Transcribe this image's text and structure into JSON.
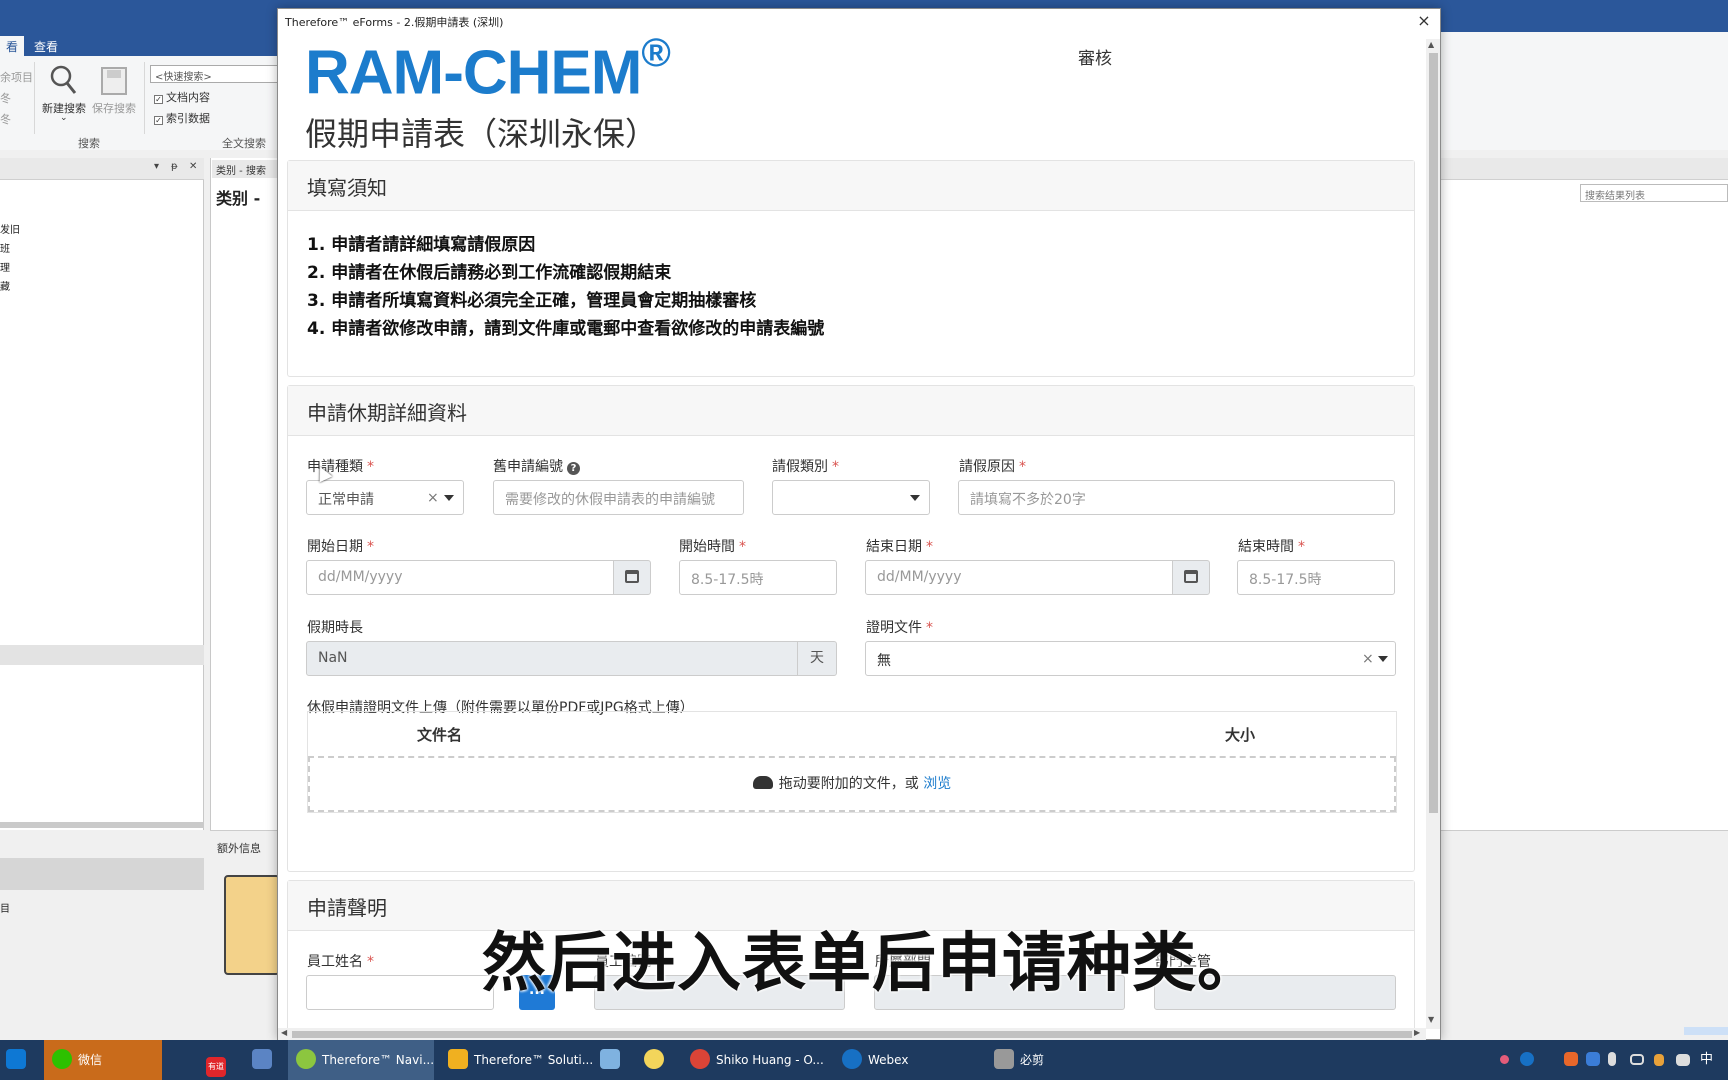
{
  "app": {
    "tabs": [
      "看",
      "查看"
    ],
    "ribbon": {
      "left_items": [
        "余项目",
        "冬",
        "冬"
      ],
      "new_search": "新建搜索",
      "save_search": "保存搜索",
      "quick_search_placeholder": "<快速搜索>",
      "checkbox_doc_content": "文档内容",
      "checkbox_index_data": "索引数据",
      "group_search": "搜索",
      "group_fulltext": "全文搜索"
    },
    "left_pane": {
      "tree_items": [
        "发旧",
        "班",
        "理",
        "藏"
      ],
      "ctl_pin": "▾",
      "ctl_float": "ᵽ",
      "ctl_close": "✕",
      "lower_label": "目"
    },
    "mid_pane": {
      "tab": "类别 - 搜索",
      "title": "类别 -",
      "extra_info": "额外信息"
    },
    "right_pane": {
      "search_placeholder": "搜索结果列表"
    }
  },
  "dialog": {
    "title": "Therefore™ eForms - 2.假期申請表 (深圳)",
    "close": "×",
    "logo": "RAM-CHEM",
    "logo_mark": "®",
    "form_title": "假期申請表（深圳永保）",
    "status": "審核",
    "notice": {
      "header": "填寫須知",
      "items": [
        "1. 申請者請詳細填寫請假原因",
        "2. 申請者在休假后請務必到工作流確認假期結束",
        "3. 申請者所填寫資料必須完全正確，管理員會定期抽樣審核",
        "4. 申請者欲修改申請，請到文件庫或電郵中查看欲修改的申請表編號"
      ]
    },
    "details": {
      "header": "申請休期詳細資料",
      "application_type": {
        "label": "申請種類",
        "value": "正常申請"
      },
      "old_app_number": {
        "label": "舊申請編號",
        "placeholder": "需要修改的休假申請表的申請編號"
      },
      "leave_type": {
        "label": "請假類別",
        "value": ""
      },
      "leave_reason": {
        "label": "請假原因",
        "placeholder": "請填寫不多於20字"
      },
      "start_date": {
        "label": "開始日期",
        "placeholder": "dd/MM/yyyy"
      },
      "start_time": {
        "label": "開始時間",
        "placeholder": "8.5-17.5時"
      },
      "end_date": {
        "label": "結束日期",
        "placeholder": "dd/MM/yyyy"
      },
      "end_time": {
        "label": "結束時間",
        "placeholder": "8.5-17.5時"
      },
      "duration": {
        "label": "假期時長",
        "value": "NaN",
        "unit": "天"
      },
      "proof_doc": {
        "label": "證明文件",
        "value": "無"
      },
      "upload_label": "休假申請證明文件上傳（附件需要以單份PDF或JPG格式上傳）",
      "upload_col_name": "文件名",
      "upload_col_size": "大小",
      "drop_text": "拖动要附加的文件，或",
      "browse": "浏览"
    },
    "declaration": {
      "header": "申請聲明",
      "employee_name": "員工姓名",
      "employee_id": "員工編號",
      "department": "所屬部門",
      "dept_head": "部門主管",
      "lookup_btn": "..."
    },
    "required_mark": "*",
    "help_mark": "?"
  },
  "subtitle": "然后进入表单后申请种类。",
  "taskbar": {
    "items": [
      {
        "label": "微信"
      },
      {
        "label": "有道"
      },
      {
        "label": "Therefore™ Navi..."
      },
      {
        "label": "Therefore™ Soluti..."
      },
      {
        "label": "Shiko Huang - O..."
      },
      {
        "label": "Webex"
      },
      {
        "label": "必剪"
      }
    ],
    "ime": "中"
  }
}
